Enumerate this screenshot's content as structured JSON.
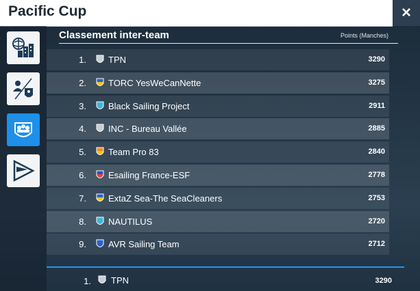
{
  "window": {
    "title": "Pacific Cup",
    "close_icon": "×"
  },
  "sidebar": {
    "items": [
      {
        "name": "city-network-icon",
        "active": false
      },
      {
        "name": "team-vs-icon",
        "active": false
      },
      {
        "name": "teams-badge-icon",
        "active": true
      },
      {
        "name": "race-flag-icon",
        "active": false
      }
    ]
  },
  "ranking": {
    "title": "Classement inter-team",
    "points_header": "Points (Manches)",
    "rows": [
      {
        "rank": "1.",
        "team": "TPN",
        "points": "3290",
        "shield": "grey"
      },
      {
        "rank": "2.",
        "team": "TORC YesWeCanNette",
        "points": "3275",
        "shield": "blue-yellow"
      },
      {
        "rank": "3.",
        "team": "Black Sailing Project",
        "points": "2911",
        "shield": "cyan"
      },
      {
        "rank": "4.",
        "team": "INC - Bureau Vallée",
        "points": "2885",
        "shield": "grey"
      },
      {
        "rank": "5.",
        "team": "Team Pro 83",
        "points": "2840",
        "shield": "orange"
      },
      {
        "rank": "6.",
        "team": "Esailing France-ESF",
        "points": "2778",
        "shield": "france"
      },
      {
        "rank": "7.",
        "team": "ExtaZ Sea-The SeaCleaners",
        "points": "2753",
        "shield": "blue-yellow"
      },
      {
        "rank": "8.",
        "team": "NAUTILUS",
        "points": "2720",
        "shield": "cyan"
      },
      {
        "rank": "9.",
        "team": "AVR Sailing Team",
        "points": "2712",
        "shield": "blue"
      }
    ],
    "my_team": {
      "rank": "1.",
      "team": "TPN",
      "points": "3290",
      "shield": "grey"
    }
  },
  "colors": {
    "accent": "#1e90e8",
    "header_bg": "#ffffff",
    "close_bg": "#2c3e50"
  }
}
